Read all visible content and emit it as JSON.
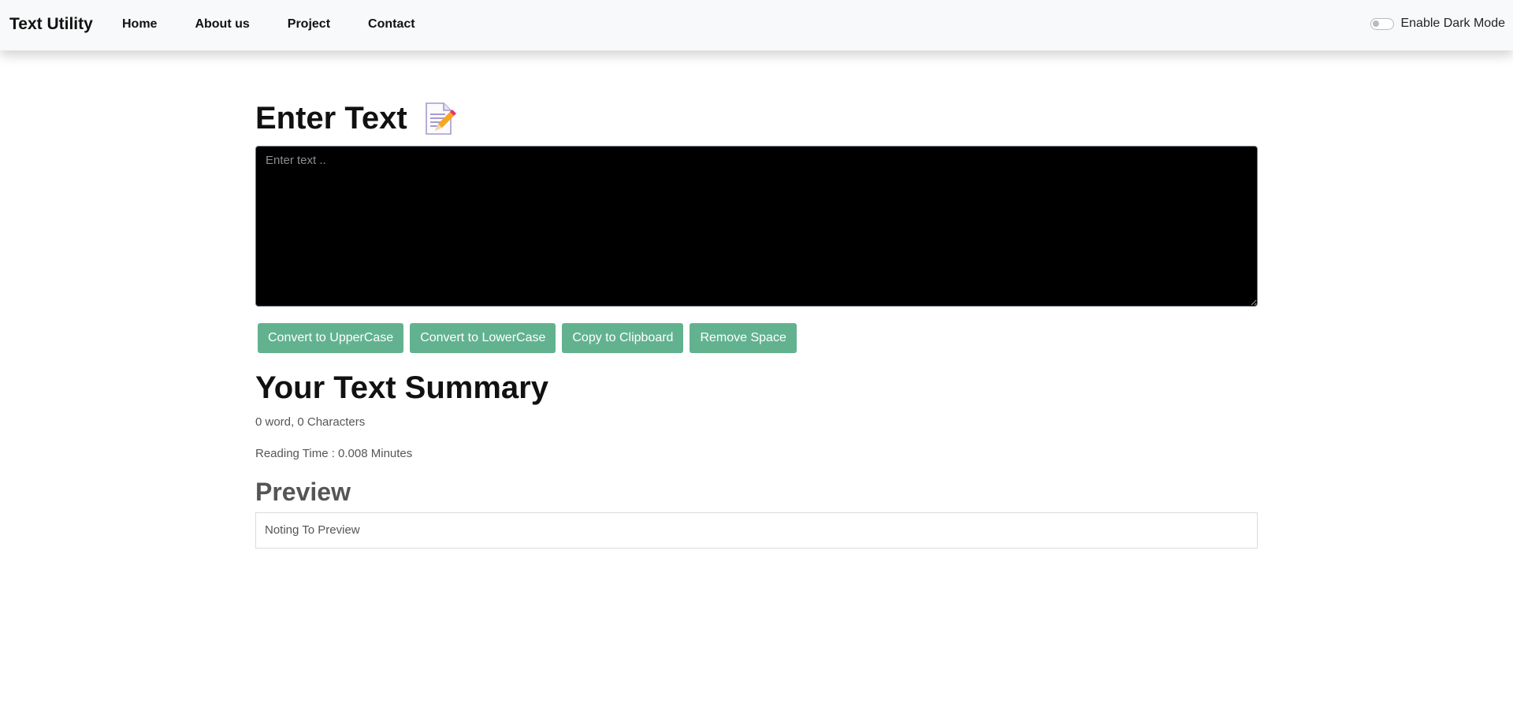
{
  "navbar": {
    "brand": "Text Utility",
    "links": [
      "Home",
      "About us",
      "Project",
      "Contact"
    ],
    "dark_mode_label": "Enable Dark Mode"
  },
  "editor": {
    "heading": "Enter Text",
    "heading_icon": "memo-icon",
    "placeholder": "Enter text ..",
    "value": ""
  },
  "buttons": {
    "uppercase": "Convert to UpperCase",
    "lowercase": "Convert to LowerCase",
    "copy": "Copy to Clipboard",
    "remove_space": "Remove Space"
  },
  "summary": {
    "heading": "Your Text Summary",
    "counts": "0 word, 0 Characters",
    "reading_time": "Reading Time : 0.008 Minutes"
  },
  "preview": {
    "heading": "Preview",
    "text": "Noting To Preview"
  },
  "colors": {
    "navbar_bg": "#f8f9fa",
    "button_bg": "#62b28f",
    "textarea_bg": "#000000"
  }
}
